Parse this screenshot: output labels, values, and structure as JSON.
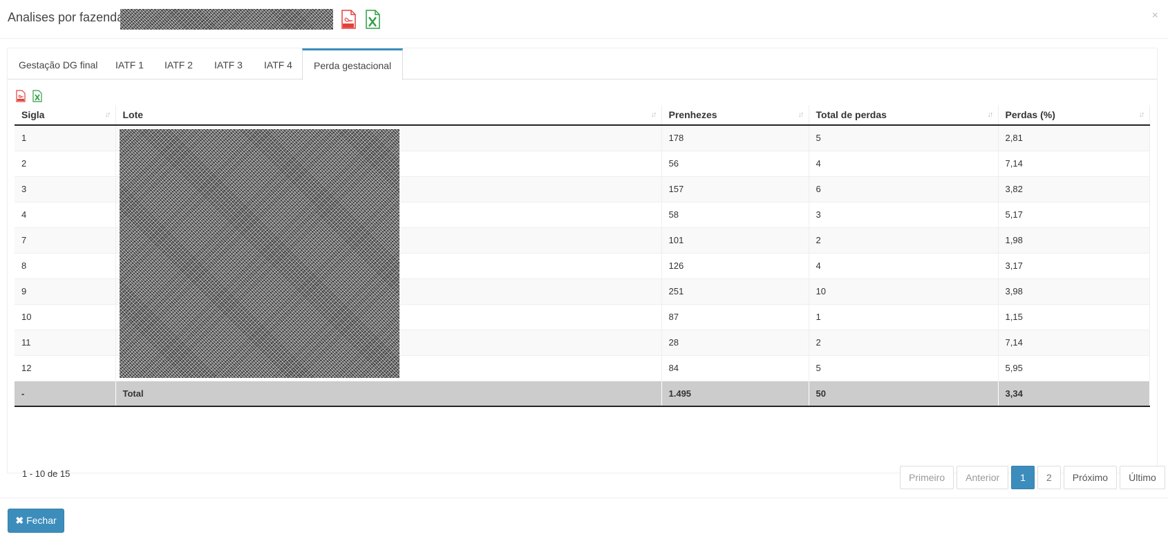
{
  "header": {
    "title": "Analises por fazendas",
    "close_symbol": "×"
  },
  "icons": {
    "pdf": "pdf-file-icon",
    "excel": "excel-file-icon",
    "close": "close-icon",
    "sort": "sort-icon",
    "times": "times-icon"
  },
  "tabs": [
    {
      "label": "Gestação DG final",
      "active": false
    },
    {
      "label": "IATF 1",
      "active": false
    },
    {
      "label": "IATF 2",
      "active": false
    },
    {
      "label": "IATF 3",
      "active": false
    },
    {
      "label": "IATF 4",
      "active": false
    },
    {
      "label": "Perda gestacional",
      "active": true
    }
  ],
  "table": {
    "columns": [
      "Sigla",
      "Lote",
      "Prenhezes",
      "Total de perdas",
      "Perdas (%)"
    ],
    "rows": [
      {
        "sigla": "1",
        "lote": "",
        "prenhezes": "178",
        "total_perdas": "5",
        "perdas_pct": "2,81"
      },
      {
        "sigla": "2",
        "lote": "",
        "prenhezes": "56",
        "total_perdas": "4",
        "perdas_pct": "7,14"
      },
      {
        "sigla": "3",
        "lote": "",
        "prenhezes": "157",
        "total_perdas": "6",
        "perdas_pct": "3,82"
      },
      {
        "sigla": "4",
        "lote": "",
        "prenhezes": "58",
        "total_perdas": "3",
        "perdas_pct": "5,17"
      },
      {
        "sigla": "7",
        "lote": "",
        "prenhezes": "101",
        "total_perdas": "2",
        "perdas_pct": "1,98"
      },
      {
        "sigla": "8",
        "lote": "",
        "prenhezes": "126",
        "total_perdas": "4",
        "perdas_pct": "3,17"
      },
      {
        "sigla": "9",
        "lote": "",
        "prenhezes": "251",
        "total_perdas": "10",
        "perdas_pct": "3,98"
      },
      {
        "sigla": "10",
        "lote": "",
        "prenhezes": "87",
        "total_perdas": "1",
        "perdas_pct": "1,15"
      },
      {
        "sigla": "11",
        "lote": "",
        "prenhezes": "28",
        "total_perdas": "2",
        "perdas_pct": "7,14"
      },
      {
        "sigla": "12",
        "lote": "",
        "prenhezes": "84",
        "total_perdas": "5",
        "perdas_pct": "5,95"
      }
    ],
    "total": {
      "sigla": "-",
      "lote": "Total",
      "prenhezes": "1.495",
      "total_perdas": "50",
      "perdas_pct": "3,34"
    }
  },
  "pagination": {
    "info": "1 - 10 de 15",
    "first": "Primeiro",
    "prev": "Anterior",
    "pages": [
      "1",
      "2"
    ],
    "current": "1",
    "next": "Próximo",
    "last": "Último"
  },
  "footer": {
    "close_label": "Fechar",
    "close_symbol": "✖"
  },
  "colors": {
    "accent": "#3c8dbc",
    "pdf_red": "#e2413b",
    "excel_green": "#2f9e44",
    "total_row": "#cccccc"
  }
}
